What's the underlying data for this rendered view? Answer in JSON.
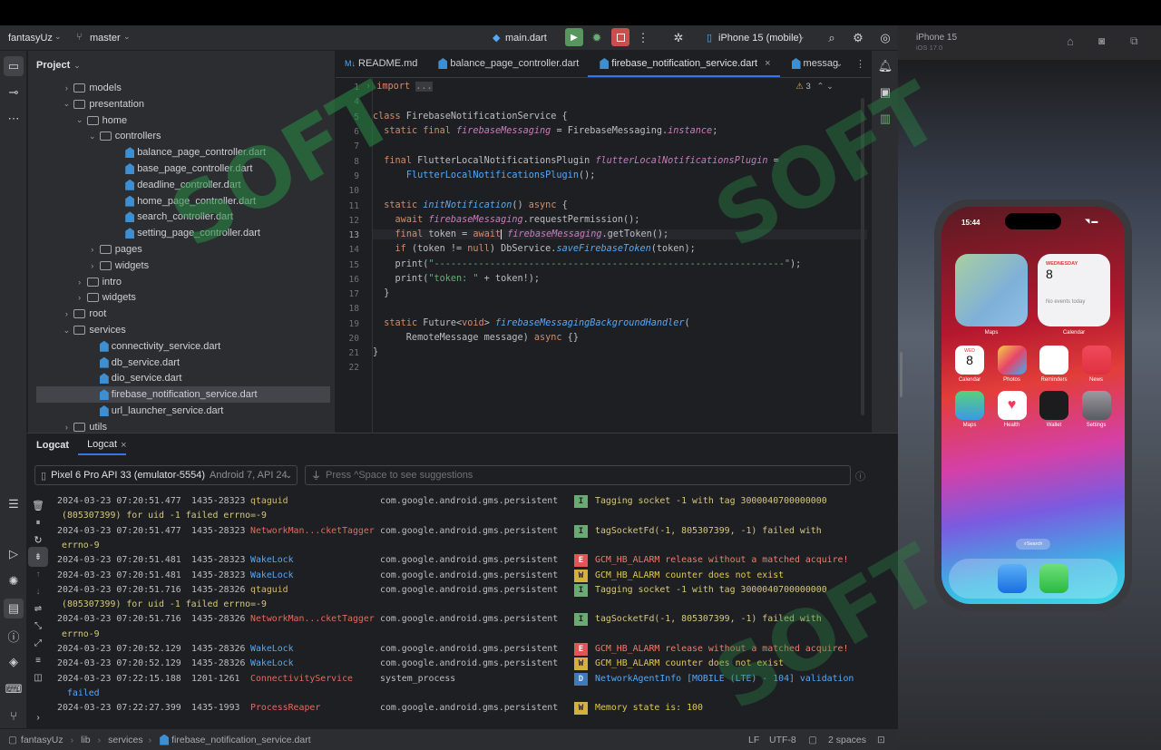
{
  "topbar": {
    "project_name": "fantasyUz",
    "branch": "master",
    "run_config": "main.dart",
    "device": "iPhone 15 (mobile)"
  },
  "project_panel": {
    "title": "Project",
    "tree": [
      {
        "label": "models",
        "type": "folder",
        "depth": 2,
        "open": false
      },
      {
        "label": "presentation",
        "type": "folder",
        "depth": 2,
        "open": true
      },
      {
        "label": "home",
        "type": "folder",
        "depth": 3,
        "open": true
      },
      {
        "label": "controllers",
        "type": "folder",
        "depth": 4,
        "open": true
      },
      {
        "label": "balance_page_controller.dart",
        "type": "dart",
        "depth": 6
      },
      {
        "label": "base_page_controller.dart",
        "type": "dart",
        "depth": 6
      },
      {
        "label": "deadline_controller.dart",
        "type": "dart",
        "depth": 6
      },
      {
        "label": "home_page_controller.dart",
        "type": "dart",
        "depth": 6
      },
      {
        "label": "search_controller.dart",
        "type": "dart",
        "depth": 6
      },
      {
        "label": "setting_page_controller.dart",
        "type": "dart",
        "depth": 6
      },
      {
        "label": "pages",
        "type": "folder",
        "depth": 4,
        "open": false
      },
      {
        "label": "widgets",
        "type": "folder",
        "depth": 4,
        "open": false
      },
      {
        "label": "intro",
        "type": "folder",
        "depth": 3,
        "open": false
      },
      {
        "label": "widgets",
        "type": "folder",
        "depth": 3,
        "open": false
      },
      {
        "label": "root",
        "type": "folder",
        "depth": 2,
        "open": false
      },
      {
        "label": "services",
        "type": "folder",
        "depth": 2,
        "open": true
      },
      {
        "label": "connectivity_service.dart",
        "type": "dart",
        "depth": 4
      },
      {
        "label": "db_service.dart",
        "type": "dart",
        "depth": 4
      },
      {
        "label": "dio_service.dart",
        "type": "dart",
        "depth": 4
      },
      {
        "label": "firebase_notification_service.dart",
        "type": "dart",
        "depth": 4,
        "selected": true
      },
      {
        "label": "url_launcher_service.dart",
        "type": "dart",
        "depth": 4
      },
      {
        "label": "utils",
        "type": "folder",
        "depth": 2,
        "open": false
      }
    ]
  },
  "editor": {
    "tabs": [
      {
        "label": "README.md",
        "prefix": "M↓"
      },
      {
        "label": "balance_page_controller.dart"
      },
      {
        "label": "firebase_notification_service.dart",
        "active": true,
        "close": "×"
      },
      {
        "label": "messag"
      }
    ],
    "warnings": "3",
    "line_numbers": [
      "1",
      "4",
      "5",
      "6",
      "7",
      "8",
      "9",
      "10",
      "11",
      "12",
      "13",
      "14",
      "15",
      "16",
      "17",
      "18",
      "19",
      "20",
      "21",
      "22"
    ],
    "current_line": "13"
  },
  "logcat": {
    "tab1": "Logcat",
    "tab2": "Logcat",
    "tab2_close": "×",
    "device": "Pixel 6 Pro API 33 (emulator-5554)",
    "device_detail": "Android 7, API 24",
    "filter_placeholder": "Press ^Space to see suggestions",
    "rows": [
      {
        "ts": "2024-03-23 07:20:51.477",
        "pid": "1435-28323",
        "tag": "qtaguid",
        "tagc": "tagy",
        "pkg": "com.google.android.gms.persistent",
        "lvl": "I",
        "msg": "Tagging socket -1 with tag 3000040700000000",
        "cont": "(805307399) for uid -1 failed errno=-9"
      },
      {
        "ts": "2024-03-23 07:20:51.477",
        "pid": "1435-28323",
        "tag": "NetworkMan...cketTagger",
        "tagc": "tagr",
        "pkg": "com.google.android.gms.persistent",
        "lvl": "I",
        "msg": "tagSocketFd(-1, 805307399, -1) failed with",
        "cont": "errno-9"
      },
      {
        "ts": "2024-03-23 07:20:51.481",
        "pid": "1435-28323",
        "tag": "WakeLock",
        "tagc": "tag",
        "pkg": "com.google.android.gms.persistent",
        "lvl": "E",
        "msg": "GCM_HB_ALARM release without a matched acquire!"
      },
      {
        "ts": "2024-03-23 07:20:51.481",
        "pid": "1435-28323",
        "tag": "WakeLock",
        "tagc": "tag",
        "pkg": "com.google.android.gms.persistent",
        "lvl": "W",
        "msg": "GCM_HB_ALARM counter does not exist"
      },
      {
        "ts": "2024-03-23 07:20:51.716",
        "pid": "1435-28326",
        "tag": "qtaguid",
        "tagc": "tagy",
        "pkg": "com.google.android.gms.persistent",
        "lvl": "I",
        "msg": "Tagging socket -1 with tag 3000040700000000",
        "cont": "(805307399) for uid -1 failed errno=-9"
      },
      {
        "ts": "2024-03-23 07:20:51.716",
        "pid": "1435-28326",
        "tag": "NetworkMan...cketTagger",
        "tagc": "tagr",
        "pkg": "com.google.android.gms.persistent",
        "lvl": "I",
        "msg": "tagSocketFd(-1, 805307399, -1) failed with",
        "cont": "errno-9"
      },
      {
        "ts": "2024-03-23 07:20:52.129",
        "pid": "1435-28326",
        "tag": "WakeLock",
        "tagc": "tag",
        "pkg": "com.google.android.gms.persistent",
        "lvl": "E",
        "msg": "GCM_HB_ALARM release without a matched acquire!"
      },
      {
        "ts": "2024-03-23 07:20:52.129",
        "pid": "1435-28326",
        "tag": "WakeLock",
        "tagc": "tag",
        "pkg": "com.google.android.gms.persistent",
        "lvl": "W",
        "msg": "GCM_HB_ALARM counter does not exist"
      },
      {
        "ts": "2024-03-23 07:22:15.188",
        "pid": "1201-1261",
        "tag": "ConnectivityService",
        "tagc": "tagr",
        "pkg": "system_process",
        "lvl": "D",
        "msg": "NetworkAgentInfo [MOBILE (LTE) - 104] validation",
        "cont": " failed"
      },
      {
        "ts": "2024-03-23 07:22:27.399",
        "pid": "1435-1993",
        "tag": "ProcessReaper",
        "tagc": "tagr",
        "pkg": "com.google.android.gms.persistent",
        "lvl": "W",
        "msg": "Memory state is: 100"
      }
    ]
  },
  "status_bar": {
    "crumbs": [
      "fantasyUz",
      "lib",
      "services",
      "firebase_notification_service.dart"
    ],
    "line_sep": "LF",
    "encoding": "UTF-8",
    "indent": "2 spaces"
  },
  "simulator": {
    "title": "iPhone 15",
    "subtitle": "iOS 17.0",
    "time": "15:44",
    "calendar_day_name": "WEDNESDAY",
    "calendar_day": "8",
    "calendar_empty": "No events today",
    "widget_labels": [
      "Maps",
      "Calendar"
    ],
    "apps": [
      "Calendar",
      "Photos",
      "Reminders",
      "News",
      "Maps",
      "Health",
      "Wallet",
      "Settings"
    ],
    "cal_icon_day": "WED",
    "cal_icon_num": "8",
    "search": "Search"
  },
  "watermark": "SOFT"
}
